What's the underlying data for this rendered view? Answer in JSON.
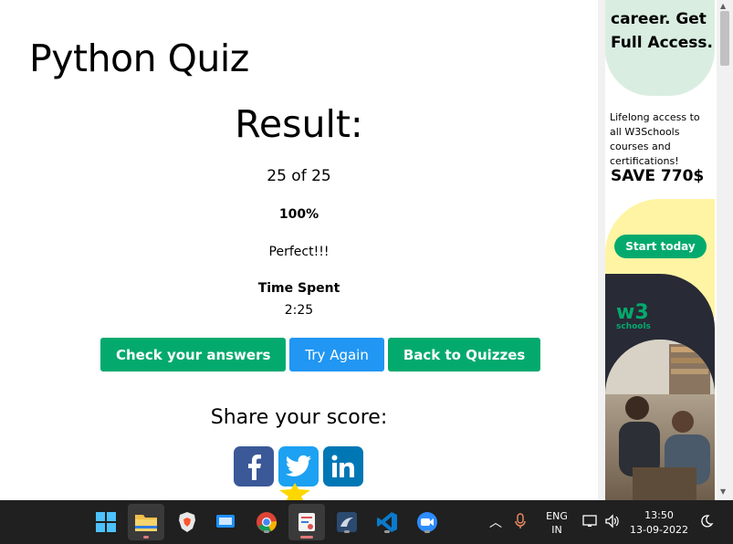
{
  "page": {
    "title": "Python Quiz",
    "result_heading": "Result:",
    "score": "25 of 25",
    "percent": "100%",
    "verdict": "Perfect!!!",
    "time_label": "Time Spent",
    "time_value": "2:25",
    "buttons": {
      "check": "Check your answers",
      "retry": "Try Again",
      "back": "Back to Quizzes"
    },
    "share_heading": "Share your score:",
    "share": [
      "facebook-icon",
      "twitter-icon",
      "linkedin-icon"
    ]
  },
  "ad": {
    "headline_line1": "career. Get",
    "headline_line2": "Full Access.",
    "body": "Lifelong access to all W3Schools courses and certifications!",
    "save": "SAVE 770$",
    "cta": "Start today",
    "logo": "w3",
    "logo_sub": "schools"
  },
  "taskbar": {
    "apps": [
      "start-icon",
      "file-explorer-icon",
      "brave-icon",
      "remote-desktop-icon",
      "chrome-icon",
      "snipping-tool-icon",
      "mysql-workbench-icon",
      "vscode-icon",
      "zoom-icon"
    ],
    "lang_line1": "ENG",
    "lang_line2": "IN",
    "time": "13:50",
    "date": "13-09-2022"
  },
  "colors": {
    "green": "#04AA6D",
    "blue": "#2196F3",
    "facebook": "#3B5998",
    "twitter": "#1DA1F2",
    "linkedin": "#0077B5"
  }
}
